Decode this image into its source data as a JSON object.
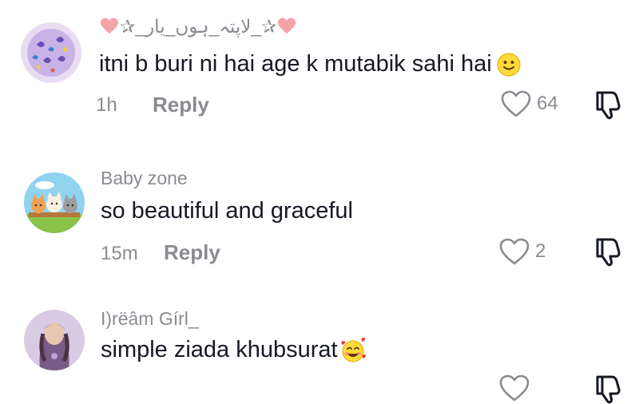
{
  "comments": [
    {
      "username": "✰_لاپتہ_ہوں_یار_✰",
      "text": "itni b buri ni hai age k mutabik sahi hai",
      "time": "1h",
      "reply_label": "Reply",
      "likes": "64"
    },
    {
      "username": "Baby zone",
      "text": "so beautiful and graceful",
      "time": "15m",
      "reply_label": "Reply",
      "likes": "2"
    },
    {
      "username": "I)rëâm Gírl_",
      "text": "simple ziada khubsurat",
      "time": "",
      "reply_label": "",
      "likes": ""
    }
  ],
  "icons": {
    "like": "heart-outline-icon",
    "dislike": "thumbs-down-icon",
    "emoji_1": "slightly-smiling-face-icon",
    "emoji_3": "smiling-face-with-hearts-icon",
    "ornament": "pink-heart-icon"
  },
  "colors": {
    "text_primary": "#161823",
    "text_secondary": "#8a8b91",
    "heart_ornament": "#f4a3a8"
  }
}
